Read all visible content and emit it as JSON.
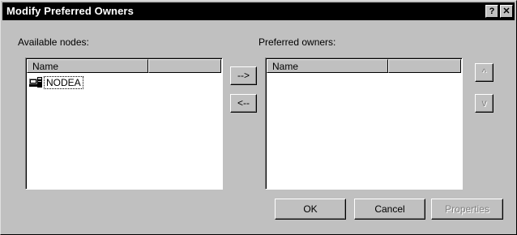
{
  "window": {
    "title": "Modify Preferred Owners",
    "help_btn": "?",
    "close_btn": "✕"
  },
  "available": {
    "label": "Available nodes:",
    "column_name": "Name",
    "items": [
      {
        "name": "NODEA",
        "icon": "computer-node-icon"
      }
    ]
  },
  "preferred": {
    "label": "Preferred owners:",
    "column_name": "Name",
    "items": []
  },
  "transfer": {
    "add_label": "-->",
    "remove_label": "<--"
  },
  "order": {
    "up_label": "^",
    "down_label": "v"
  },
  "buttons": {
    "ok": "OK",
    "cancel": "Cancel",
    "properties": "Properties"
  }
}
